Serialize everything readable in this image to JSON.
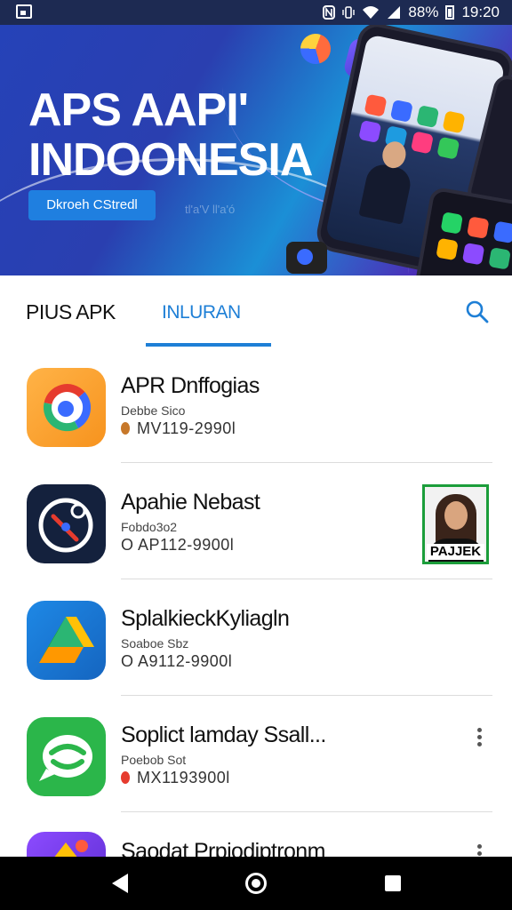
{
  "status_bar": {
    "time": "19:20",
    "battery_text": "88%",
    "icons": [
      "screenshot-icon",
      "nfc-icon",
      "vibrate-icon",
      "wifi-icon",
      "signal-icon",
      "battery-icon"
    ]
  },
  "banner": {
    "title_line1": "APS AAPI'",
    "title_line2": "INDOONESIA",
    "button_label": "Dkroeh CStredl",
    "faint_text": "tl'a'V ll'a'ó"
  },
  "tabs": [
    {
      "label": "PIUS APK",
      "active": false
    },
    {
      "label": "INLURAN",
      "active": true
    }
  ],
  "accent_color": "#1e7fd6",
  "apps": [
    {
      "title": "APR Dnffogias",
      "subtitle": "Debbe Sico",
      "id_text": "MV119-2990l",
      "icon": "chrome-like-icon"
    },
    {
      "title": "Apahie Nebast",
      "subtitle": "Fobdo3o2",
      "id_text": "O AP112-9900l",
      "icon": "compass-icon"
    },
    {
      "title": "SplalkieckKyliagln",
      "subtitle": "Soaboe Sbz",
      "id_text": "O A9112-9900l",
      "icon": "drive-icon"
    },
    {
      "title": "Soplict lamday Ssall...",
      "subtitle": "Poebob Sot",
      "id_text": "MX1193900l",
      "icon": "chat-icon"
    },
    {
      "title": "Saodat Prpiodiptronm",
      "subtitle": "",
      "id_text": "",
      "icon": "app-icon"
    }
  ],
  "thumbnail": {
    "label": "PAJJEK"
  }
}
